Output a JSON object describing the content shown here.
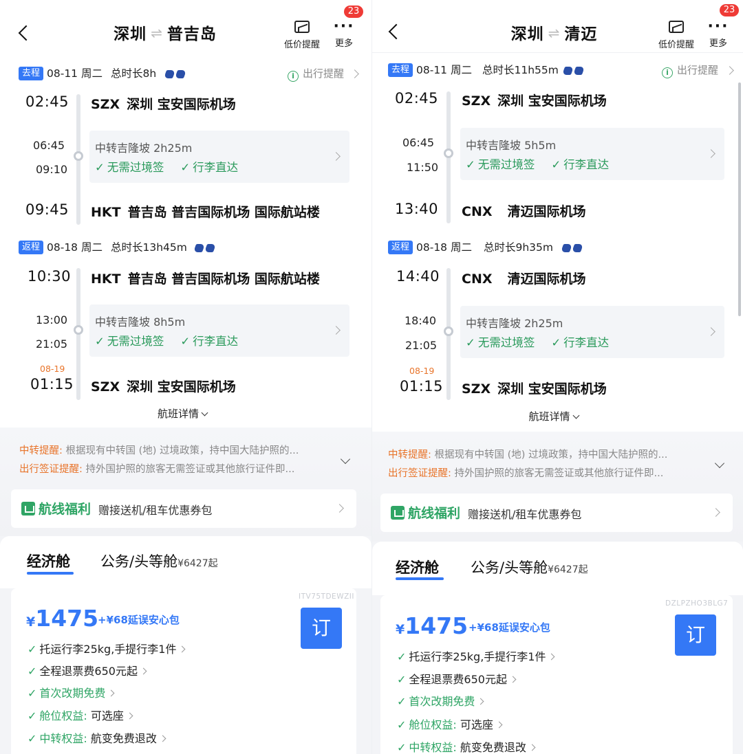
{
  "header": {
    "low_price_alert": "低价提醒",
    "more": "更多",
    "badge_count": "23",
    "arrow_glyph": "⇌"
  },
  "left": {
    "title_from": "深圳",
    "title_to": "普吉岛",
    "outbound": {
      "tag": "去程",
      "date": "08-11 周二",
      "duration": "总时长8h",
      "reminder": "出行提醒",
      "dep_time": "02:45",
      "dep_code": "SZX",
      "dep_airport": "深圳 宝安国际机场",
      "arr_transfer_time": "06:45",
      "dep_transfer_time": "09:10",
      "transfer_title": "中转吉隆坡 2h25m",
      "tag_visa": "无需过境签",
      "tag_luggage": "行李直达",
      "arr_time": "09:45",
      "arr_code": "HKT",
      "arr_airport": "普吉岛 普吉国际机场 国际航站楼"
    },
    "return": {
      "tag": "返程",
      "date": "08-18 周二",
      "duration": "总时长13h45m",
      "dep_time": "10:30",
      "dep_code": "HKT",
      "dep_airport": "普吉岛 普吉国际机场 国际航站楼",
      "arr_transfer_time": "13:00",
      "dep_transfer_time": "21:05",
      "transfer_title": "中转吉隆坡 8h5m",
      "tag_visa": "无需过境签",
      "tag_luggage": "行李直达",
      "next_day": "08-19",
      "arr_time": "01:15",
      "arr_code": "SZX",
      "arr_airport": "深圳 宝安国际机场"
    },
    "flight_detail": "航班详情",
    "notice1_key": "中转提醒:",
    "notice1_text": " 根据现有中转国 (地) 过境政策，持中国大陆护照的...",
    "notice2_key": "出行签证提醒:",
    "notice2_text": " 持外国护照的旅客无需签证或其他旅行证件即...",
    "benefit_title": "航线福利",
    "benefit_desc": "赠接送机/租车优惠券包",
    "tab_economy": "经济舱",
    "tab_business": "公务/头等舱",
    "tab_business_price": "¥6427起",
    "fare_code": "ITV75TDEWZII",
    "price_currency": "¥",
    "price": "1475",
    "addon": "+¥68延误安心包",
    "book": "订",
    "features": {
      "f1": "托运行李25kg,手提行李1件",
      "f2": "全程退票费650元起",
      "f3": "首次改期免费",
      "f4_key": "舱位权益:",
      "f4_val": " 可选座",
      "f5_key": "中转权益:",
      "f5_val": " 航变免费退改"
    }
  },
  "right": {
    "title_from": "深圳",
    "title_to": "清迈",
    "outbound": {
      "tag": "去程",
      "date": "08-11 周二",
      "duration": "总时长11h55m",
      "reminder": "出行提醒",
      "dep_time": "02:45",
      "dep_code": "SZX",
      "dep_airport": "深圳 宝安国际机场",
      "arr_transfer_time": "06:45",
      "dep_transfer_time": "11:50",
      "transfer_title": "中转吉隆坡 5h5m",
      "tag_visa": "无需过境签",
      "tag_luggage": "行李直达",
      "arr_time": "13:40",
      "arr_code": "CNX",
      "arr_airport": "清迈国际机场"
    },
    "return": {
      "tag": "返程",
      "date": "08-18 周二",
      "duration": "总时长9h35m",
      "dep_time": "14:40",
      "dep_code": "CNX",
      "dep_airport": "清迈国际机场",
      "arr_transfer_time": "18:40",
      "dep_transfer_time": "21:05",
      "transfer_title": "中转吉隆坡 2h25m",
      "tag_visa": "无需过境签",
      "tag_luggage": "行李直达",
      "next_day": "08-19",
      "arr_time": "01:15",
      "arr_code": "SZX",
      "arr_airport": "深圳 宝安国际机场"
    },
    "flight_detail": "航班详情",
    "notice1_key": "中转提醒:",
    "notice1_text": " 根据现有中转国 (地) 过境政策，持中国大陆护照的...",
    "notice2_key": "出行签证提醒:",
    "notice2_text": " 持外国护照的旅客无需签证或其他旅行证件即...",
    "benefit_title": "航线福利",
    "benefit_desc": "赠接送机/租车优惠券包",
    "tab_economy": "经济舱",
    "tab_business": "公务/头等舱",
    "tab_business_price": "¥6427起",
    "fare_code": "DZLPZHO3BLG7",
    "price_currency": "¥",
    "price": "1475",
    "addon": "+¥68延误安心包",
    "book": "订",
    "features": {
      "f1": "托运行李25kg,手提行李1件",
      "f2": "全程退票费650元起",
      "f3": "首次改期免费",
      "f4_key": "舱位权益:",
      "f4_val": " 可选座",
      "f5_key": "中转权益:",
      "f5_val": " 航变免费退改"
    }
  },
  "colors": {
    "accent": "#3478f6",
    "green": "#2fa565",
    "orange": "#e8742a",
    "badge": "#ef3b36"
  }
}
